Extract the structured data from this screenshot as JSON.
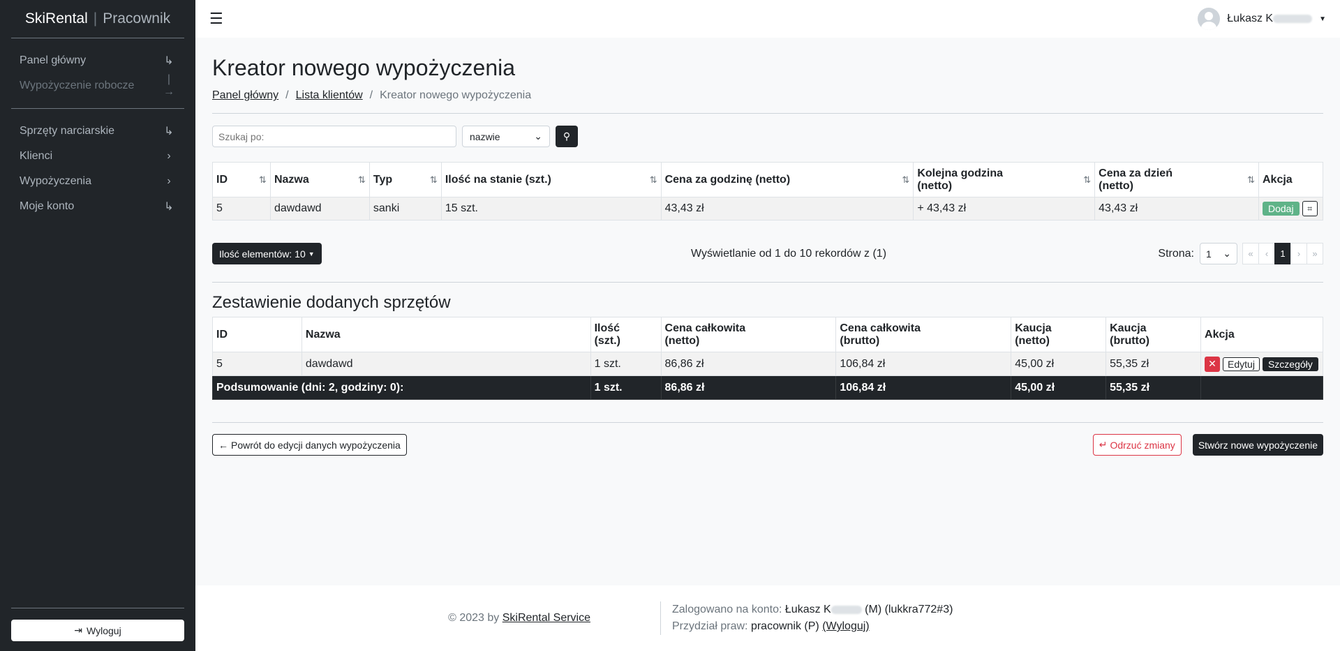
{
  "brand": {
    "name": "SkiRental",
    "separator": "|",
    "role": "Pracownik"
  },
  "sidebar": {
    "group1": [
      {
        "label": "Panel główny",
        "icon": "↳"
      },
      {
        "label": "Wypożyczenie robocze",
        "icon": "|→"
      }
    ],
    "group2": [
      {
        "label": "Sprzęty narciarskie",
        "icon": "↳"
      },
      {
        "label": "Klienci",
        "icon": "›"
      },
      {
        "label": "Wypożyczenia",
        "icon": "›"
      },
      {
        "label": "Moje konto",
        "icon": "↳"
      }
    ],
    "logout_label": "Wyloguj"
  },
  "header": {
    "user_name": "Łukasz K"
  },
  "page": {
    "title": "Kreator nowego wypożyczenia",
    "breadcrumb": [
      "Panel główny",
      "Lista klientów",
      "Kreator nowego wypożyczenia"
    ]
  },
  "search": {
    "placeholder": "Szukaj po:",
    "field": "nazwie"
  },
  "equipment_table": {
    "headers": [
      "ID",
      "Nazwa",
      "Typ",
      "Ilość na stanie (szt.)",
      "Cena za godzinę (netto)",
      "Kolejna godzina\n(netto)",
      "Cena za dzień\n(netto)",
      "Akcja"
    ],
    "rows": [
      {
        "id": "5",
        "name": "dawdawd",
        "type": "sanki",
        "stock": "15 szt.",
        "price_hour": "43,43 zł",
        "next_hour": "+ 43,43 zł",
        "price_day": "43,43 zł",
        "add_label": "Dodaj"
      }
    ]
  },
  "pagination": {
    "page_size_label": "Ilość elementów: 10",
    "info": "Wyświetlanie od 1 do 10 rekordów z (1)",
    "page_label": "Strona:",
    "page_value": "1",
    "current_page": "1"
  },
  "summary": {
    "title": "Zestawienie dodanych sprzętów",
    "headers": [
      "ID",
      "Nazwa",
      "Ilość\n(szt.)",
      "Cena całkowita\n(netto)",
      "Cena całkowita\n(brutto)",
      "Kaucja\n(netto)",
      "Kaucja\n(brutto)",
      "Akcja"
    ],
    "rows": [
      {
        "id": "5",
        "name": "dawdawd",
        "qty": "1 szt.",
        "total_net": "86,86 zł",
        "total_gross": "106,84 zł",
        "deposit_net": "45,00 zł",
        "deposit_gross": "55,35 zł",
        "edit_label": "Edytuj",
        "details_label": "Szczegóły"
      }
    ],
    "totals": {
      "label": "Podsumowanie (dni: 2, godziny: 0):",
      "qty": "1 szt.",
      "total_net": "86,86 zł",
      "total_gross": "106,84 zł",
      "deposit_net": "45,00 zł",
      "deposit_gross": "55,35 zł"
    }
  },
  "actions": {
    "back_label": "Powrót do edycji danych wypożyczenia",
    "discard_label": "Odrzuć zmiany",
    "create_label": "Stwórz nowe wypożyczenie"
  },
  "footer": {
    "copyright_prefix": "© 2023 by",
    "link": "SkiRental Service",
    "logged_label": "Zalogowano na konto:",
    "logged_user": "Łukasz K",
    "logged_user_suffix": "(M) (lukkra772#3)",
    "rights_label": "Przydział praw:",
    "rights_value": "pracownik (P)",
    "logout_link": "(Wyloguj)"
  }
}
